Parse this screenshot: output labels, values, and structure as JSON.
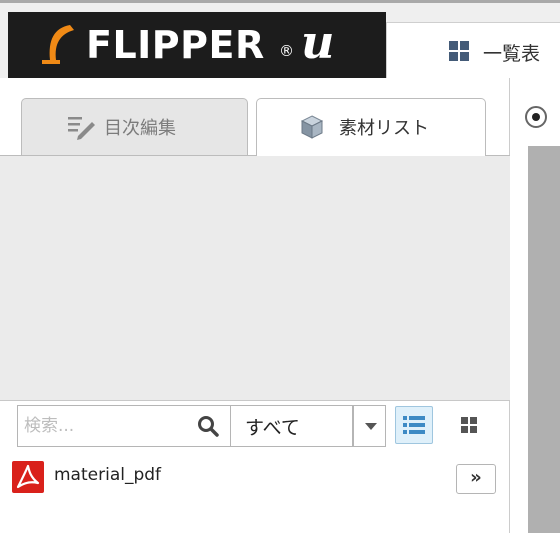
{
  "header": {
    "logo_text": "FLIPPER",
    "logo_reg_mark": "®",
    "logo_suffix": "u",
    "list_tab_label": "一覧表"
  },
  "panel_tabs": {
    "toc_label": "目次編集",
    "materials_label": "素材リスト"
  },
  "toolbar": {
    "search_placeholder": "検索...",
    "filter_value": "すべて"
  },
  "files": [
    {
      "name": "material_pdf",
      "icon": "pdf-icon"
    }
  ],
  "expand_label": "»",
  "colors": {
    "logo_bg": "#1c1c1c",
    "accent_orange": "#f08a16",
    "pdf_red": "#d9211b",
    "active_view_bg": "#dff0fa",
    "view_icon_blue": "#3d8ac4"
  }
}
